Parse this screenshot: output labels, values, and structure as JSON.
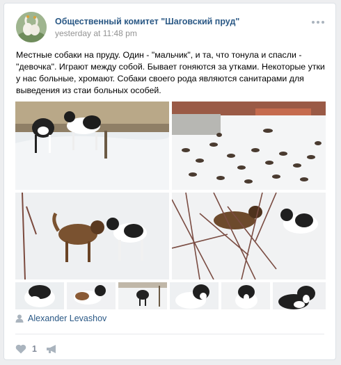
{
  "post": {
    "group_name": "Общественный комитет \"Шаговский пруд\"",
    "date": "yesterday at 11:48 pm",
    "text": "Местные собаки на пруду. Один - \"мальчик\", и та, что тонула и спасли - \"девочка\". Играют между собой. Бывает гоняются за утками. Некоторые утки у нас больные, хромают. Собаки своего рода являются санитарами для выведения из стаи больных особей.",
    "author": "Alexander Levashov",
    "likes": "1"
  },
  "icons": {
    "more": "more-dots-icon",
    "author": "person-icon",
    "like": "heart-icon",
    "share": "megaphone-icon"
  },
  "colors": {
    "link": "#2a5885",
    "meta": "#939393",
    "icon": "#aab4be"
  }
}
